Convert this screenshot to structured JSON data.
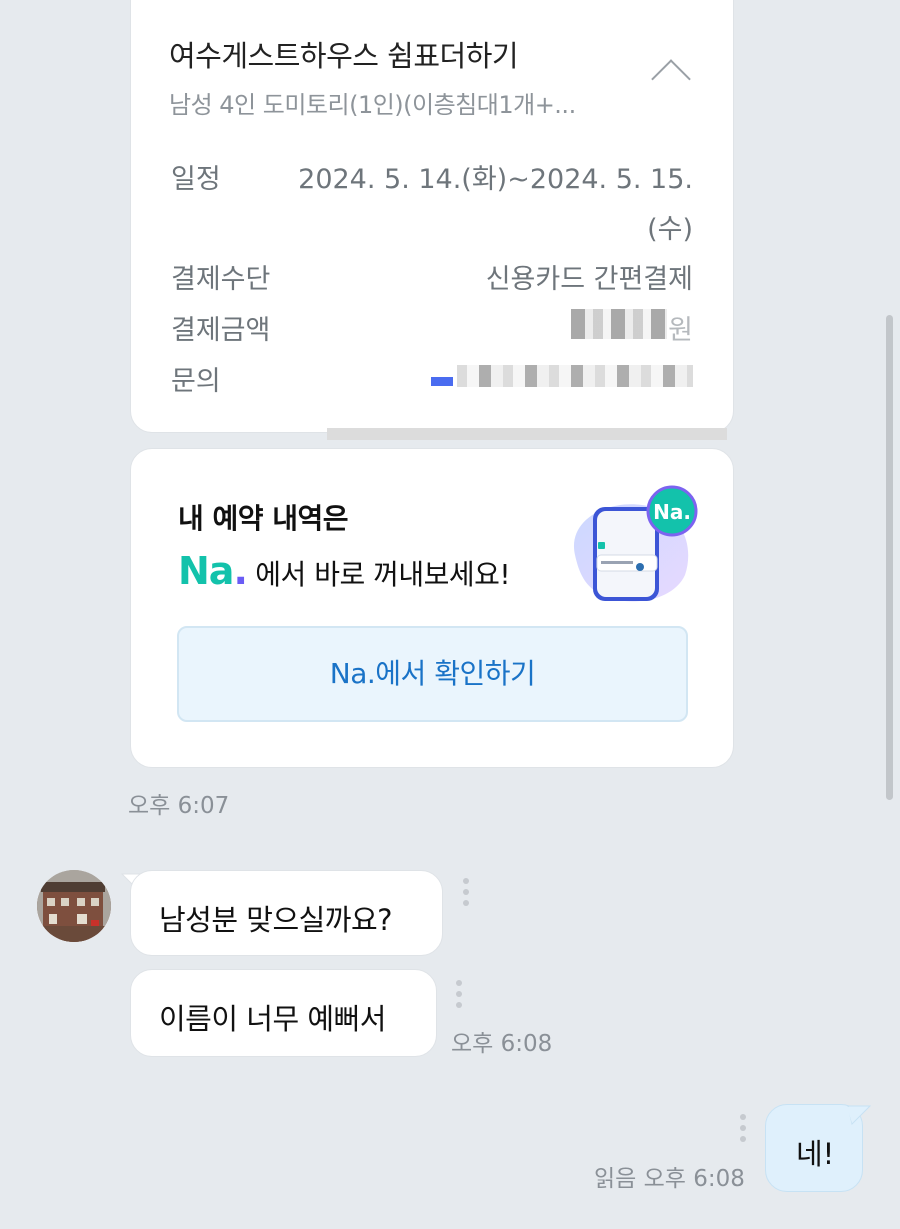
{
  "reservation": {
    "title": "여수게스트하우스 쉼표더하기",
    "subtitle": "남성 4인 도미토리(1인)(이층침대1개+...",
    "rows": [
      {
        "label": "일정",
        "value_line1": "2024. 5. 14.(화)~2024. 5. 15.",
        "value_line2": "(수)"
      },
      {
        "label": "결제수단",
        "value": "신용카드 간편결제"
      },
      {
        "label": "결제금액",
        "value_suffix": "원"
      },
      {
        "label": "문의"
      }
    ]
  },
  "na_card": {
    "line1": "내 예약 내역은",
    "logo_text": "Na",
    "logo_dot": ".",
    "line2_text": " 에서 바로 꺼내보세요!",
    "badge": "Na.",
    "button_label": "Na.에서 확인하기"
  },
  "messages": {
    "time1": "오후 6:07",
    "bubble1": "남성분 맞으실까요?",
    "bubble2": "이름이 너무 예뻐서",
    "time2": "오후 6:08",
    "my_bubble": "네!",
    "read_time": "읽음 오후 6:08"
  },
  "colors": {
    "background": "#e6eaee",
    "na_green": "#13c2ab",
    "na_purple": "#6a5cf5",
    "link_blue": "#1a73c7",
    "my_bubble_bg": "#dff0fc"
  }
}
